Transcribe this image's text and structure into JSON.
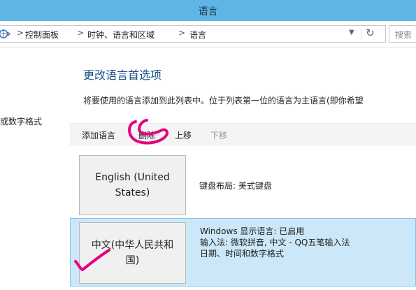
{
  "window": {
    "title": "语言"
  },
  "address_bar": {
    "crumbs": [
      "控制面板",
      "时钟、语言和区域",
      "语言"
    ],
    "separator": ">",
    "search_placeholder": "搜索"
  },
  "sidebar": {
    "link_partial": "或数字格式"
  },
  "main": {
    "title": "更改语言首选项",
    "description": "将要使用的语言添加到此列表中。位于列表第一位的语言为主语言(即你希望"
  },
  "toolbar": {
    "add_label": "添加语言",
    "remove_label": "删除",
    "up_label": "上移",
    "down_label": "下移"
  },
  "languages": [
    {
      "name": "English (United States)",
      "details": [
        "键盘布局: 美式键盘"
      ],
      "selected": false
    },
    {
      "name": "中文(中华人民共和国)",
      "details": [
        "Windows 显示语言: 已启用",
        "输入法: 微软拼音, 中文 - QQ五笔输入法",
        "日期、时间和数字格式"
      ],
      "selected": true
    }
  ],
  "colors": {
    "titlebar": "#5fb5e6",
    "selected_row": "#cce8f8",
    "annotation": "#e4007f",
    "link_title": "#1a4f8a"
  }
}
